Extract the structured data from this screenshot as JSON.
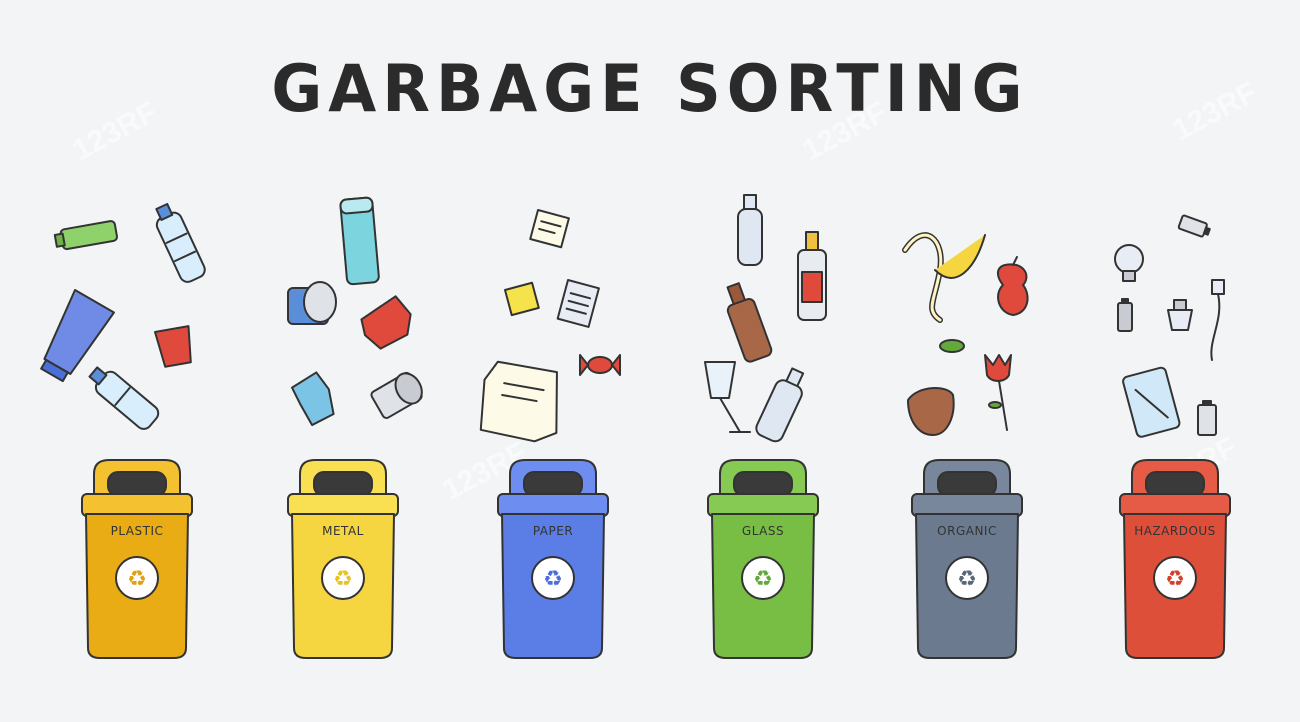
{
  "title": "GARBAGE SORTING",
  "watermark": "123RF",
  "bins": [
    {
      "label": "PLASTIC",
      "color": "#e9ac14",
      "lid": "#f4c230",
      "icon": "#e0a010"
    },
    {
      "label": "METAL",
      "color": "#f5d641",
      "lid": "#f9df52",
      "icon": "#e6c327"
    },
    {
      "label": "PAPER",
      "color": "#5b7ee6",
      "lid": "#6e8df0",
      "icon": "#4a6fd8"
    },
    {
      "label": "GLASS",
      "color": "#78be44",
      "lid": "#86c953",
      "icon": "#62a83a"
    },
    {
      "label": "ORGANIC",
      "color": "#6b7a8f",
      "lid": "#78879b",
      "icon": "#5a6778"
    },
    {
      "label": "HAZARDOUS",
      "color": "#de4f3a",
      "lid": "#e55b45",
      "icon": "#d3402b"
    }
  ],
  "icons": [
    "recycle-icon",
    "bottle-icon",
    "can-icon",
    "paper-icon",
    "banana-icon",
    "battery-icon",
    "bulb-icon"
  ]
}
